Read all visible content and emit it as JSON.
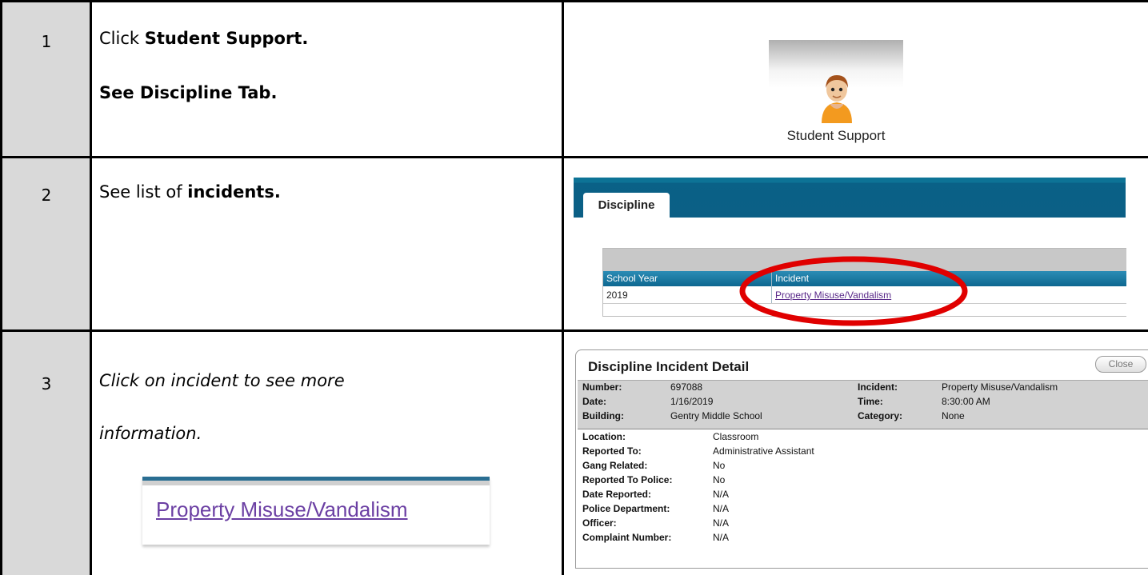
{
  "rows": [
    {
      "num": "1",
      "line1_prefix": "Click ",
      "line1_bold": "Student Support.",
      "line2_bold": "See Discipline Tab.",
      "image_label": "Student Support"
    },
    {
      "num": "2",
      "text_prefix": "See list of ",
      "text_bold": "incidents.",
      "tab_label": "Discipline",
      "columns": [
        "School Year",
        "Incident"
      ],
      "cells": [
        "2019",
        "Property Misuse/Vandalism"
      ]
    },
    {
      "num": "3",
      "line1": "Click on incident to see more",
      "line2": "information.",
      "link_label": "Property Misuse/Vandalism"
    }
  ],
  "detail": {
    "title": "Discipline Incident Detail",
    "close_label": "Close",
    "header_fields": [
      {
        "label": "Number:",
        "value": "697088"
      },
      {
        "label": "Date:",
        "value": "1/16/2019"
      },
      {
        "label": "Building:",
        "value": "Gentry Middle School"
      },
      {
        "label": "Incident:",
        "value": "Property Misuse/Vandalism"
      },
      {
        "label": "Time:",
        "value": "8:30:00 AM"
      },
      {
        "label": "Category:",
        "value": "None"
      }
    ],
    "fields": [
      {
        "label": "Location:",
        "value": "Classroom"
      },
      {
        "label": "Reported To:",
        "value": "Administrative Assistant"
      },
      {
        "label": "Gang Related:",
        "value": "No"
      },
      {
        "label": "Reported To Police:",
        "value": "No"
      },
      {
        "label": "Date Reported:",
        "value": "N/A"
      },
      {
        "label": "Police Department:",
        "value": "N/A"
      },
      {
        "label": "Officer:",
        "value": "N/A"
      },
      {
        "label": "Complaint Number:",
        "value": "N/A"
      }
    ]
  },
  "colors": {
    "step_column": "#d9d9d9",
    "tab_bar": "#0b5f85",
    "highlight_ellipse": "#e00000",
    "link": "#5a2a8a"
  }
}
